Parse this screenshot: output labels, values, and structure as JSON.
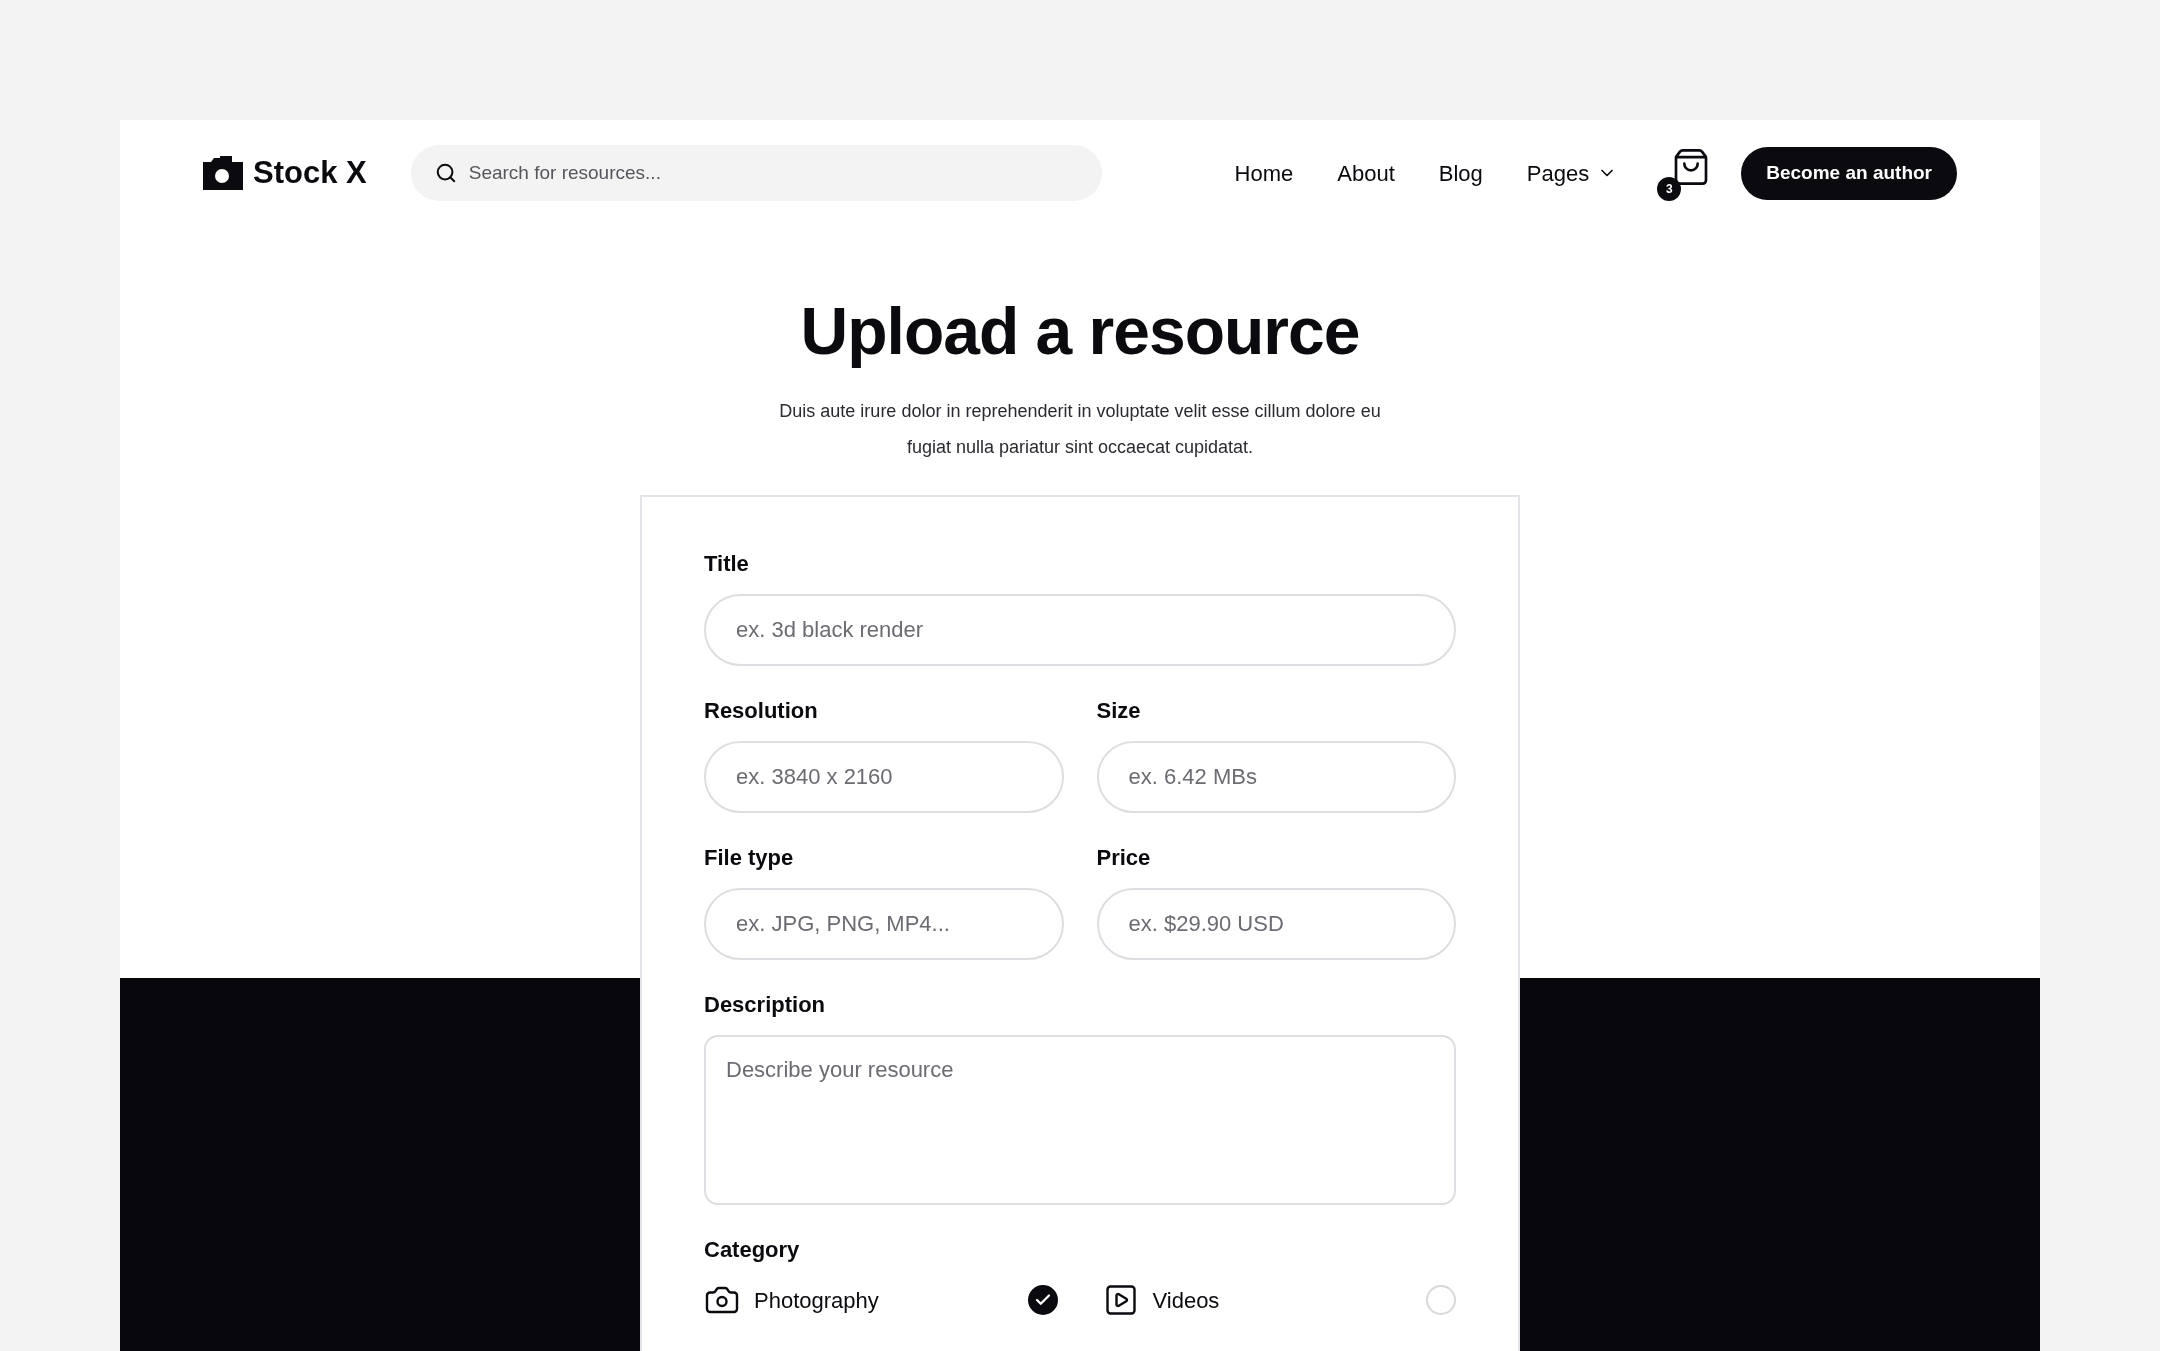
{
  "header": {
    "logo": "Stock X",
    "search": {
      "placeholder": "Search for resources..."
    },
    "nav": [
      {
        "label": "Home",
        "dropdown": false
      },
      {
        "label": "About",
        "dropdown": false
      },
      {
        "label": "Blog",
        "dropdown": false
      },
      {
        "label": "Pages",
        "dropdown": true
      }
    ],
    "cart_count": "3",
    "cta": "Become an author"
  },
  "hero": {
    "title": "Upload a resource",
    "subtitle": "Duis aute irure dolor in reprehenderit in voluptate velit esse cillum dolore eu fugiat nulla pariatur sint occaecat cupidatat."
  },
  "form": {
    "rows": [
      [
        {
          "label": "Title",
          "placeholder": "ex. 3d black render"
        }
      ],
      [
        {
          "label": "Resolution",
          "placeholder": "ex. 3840 x 2160"
        },
        {
          "label": "Size",
          "placeholder": "ex. 6.42 MBs"
        }
      ],
      [
        {
          "label": "File type",
          "placeholder": "ex. JPG, PNG, MP4..."
        },
        {
          "label": "Price",
          "placeholder": "ex. $29.90 USD"
        }
      ]
    ],
    "description": {
      "label": "Description",
      "placeholder": "Describe your resource"
    },
    "category": {
      "label": "Category",
      "options": [
        {
          "label": "Photography",
          "kind": "camera",
          "selected": true
        },
        {
          "label": "Videos",
          "kind": "video",
          "selected": false
        }
      ]
    }
  }
}
